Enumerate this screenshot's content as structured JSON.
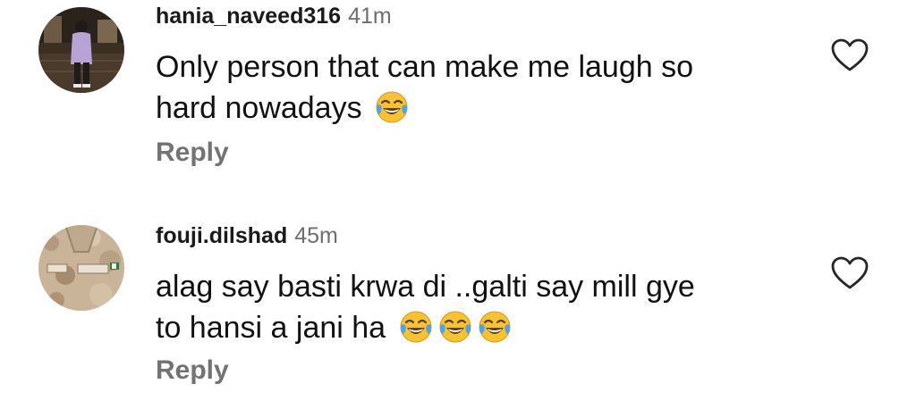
{
  "comments": [
    {
      "username": "hania_naveed316",
      "time": "41m",
      "text_line1": "Only person that can make me laugh so",
      "text_line2": "hard nowadays",
      "emojis": [
        "face-with-tears-of-joy"
      ],
      "reply_label": "Reply"
    },
    {
      "username": "fouji.dilshad",
      "time": "45m",
      "text_line1": "alag say basti krwa di ..galti say mill gye",
      "text_line2": "to hansi a jani ha",
      "emojis": [
        "face-with-tears-of-joy",
        "face-with-tears-of-joy",
        "face-with-tears-of-joy"
      ],
      "reply_label": "Reply"
    }
  ],
  "colors": {
    "username": "#1a1a1a",
    "timestamp": "#6e6e6e",
    "reply": "#737373",
    "heart_outline": "#262626"
  }
}
